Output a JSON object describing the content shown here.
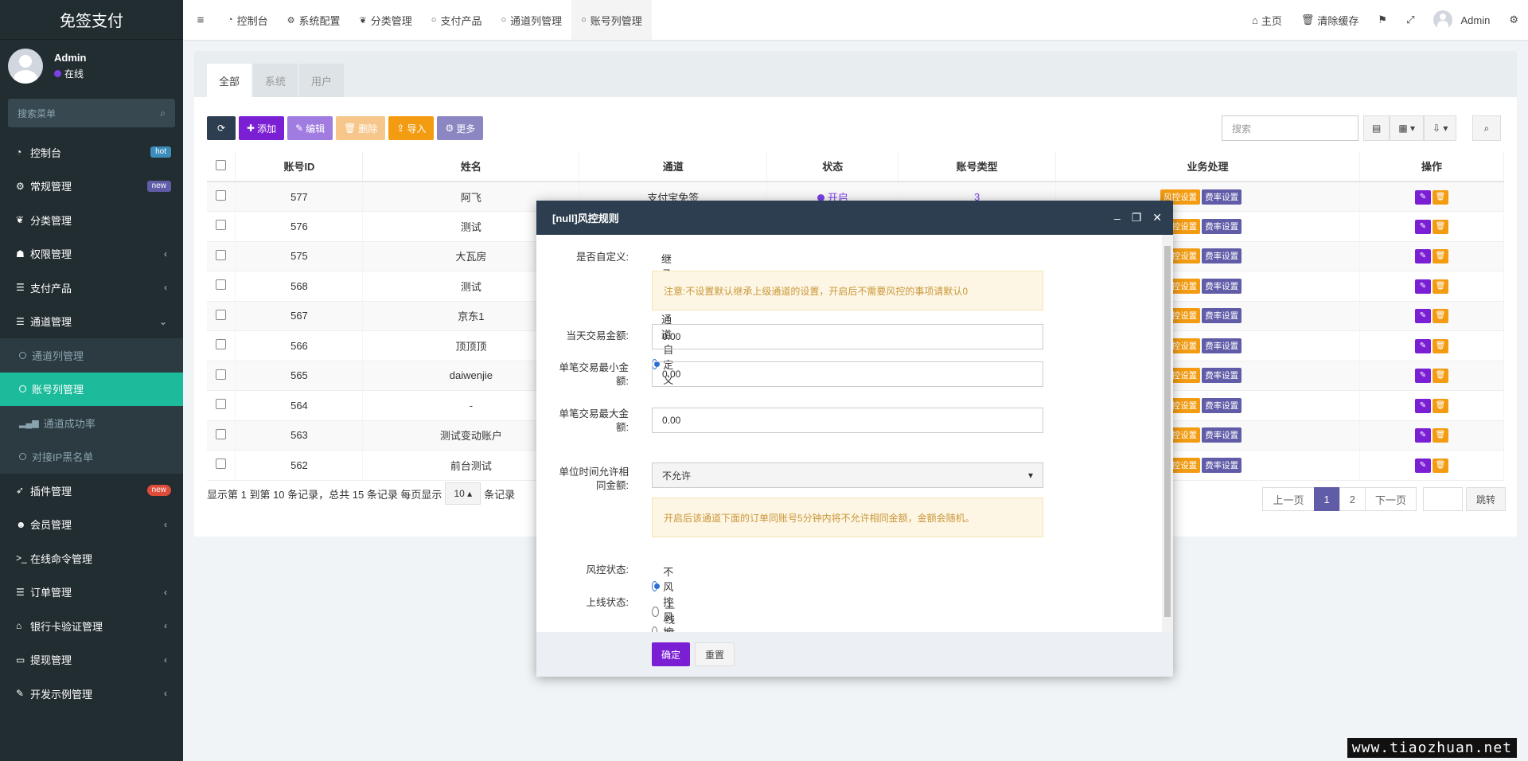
{
  "brand": "免签支付",
  "user": {
    "name": "Admin",
    "status": "在线"
  },
  "sidebar_search_placeholder": "搜索菜单",
  "menu": [
    {
      "icon": "◔",
      "label": "控制台",
      "badge": "hot"
    },
    {
      "icon": "⚙",
      "label": "常规管理",
      "badge": "new"
    },
    {
      "icon": "❦",
      "label": "分类管理"
    },
    {
      "icon": "☗",
      "label": "权限管理",
      "caret": "‹"
    },
    {
      "icon": "☰",
      "label": "支付产品",
      "caret": "‹"
    },
    {
      "icon": "☰",
      "label": "通道管理",
      "caret": "⌄"
    }
  ],
  "submenu": [
    {
      "label": "通道列管理"
    },
    {
      "label": "账号列管理"
    },
    {
      "label": "通道成功率"
    },
    {
      "label": "对接IP黑名单"
    }
  ],
  "menu2": [
    {
      "icon": "➶",
      "label": "插件管理",
      "badge": "new"
    },
    {
      "icon": "☻",
      "label": "会员管理",
      "caret": "‹"
    },
    {
      "icon": ">_",
      "label": "在线命令管理"
    },
    {
      "icon": "☰",
      "label": "订单管理",
      "caret": "‹"
    },
    {
      "icon": "⌂",
      "label": "银行卡验证管理",
      "caret": "‹"
    },
    {
      "icon": "▭",
      "label": "提现管理",
      "caret": "‹"
    },
    {
      "icon": "✎",
      "label": "开发示例管理",
      "caret": "‹"
    }
  ],
  "topbar": {
    "tabs": [
      {
        "icon": "◔",
        "label": "控制台"
      },
      {
        "icon": "⚙",
        "label": "系统配置"
      },
      {
        "icon": "❦",
        "label": "分类管理"
      },
      {
        "icon": "○",
        "label": "支付产品"
      },
      {
        "icon": "○",
        "label": "通道列管理"
      },
      {
        "icon": "○",
        "label": "账号列管理"
      }
    ],
    "home": "主页",
    "clear_cache": "清除缓存",
    "admin": "Admin"
  },
  "panel_tabs": [
    "全部",
    "系统",
    "用户"
  ],
  "toolbar": {
    "add": "添加",
    "edit": "编辑",
    "delete": "删除",
    "import": "导入",
    "more": "更多"
  },
  "search_placeholder": "搜索",
  "columns": [
    "账号ID",
    "姓名",
    "通道",
    "状态",
    "账号类型",
    "业务处理",
    "操作"
  ],
  "rows": [
    {
      "id": "577",
      "name": "阿飞",
      "channel": "支付宝免签",
      "status": "开启",
      "type": "3"
    },
    {
      "id": "576",
      "name": "测试"
    },
    {
      "id": "575",
      "name": "大瓦房"
    },
    {
      "id": "568",
      "name": "测试"
    },
    {
      "id": "567",
      "name": "京东1"
    },
    {
      "id": "566",
      "name": "顶顶顶"
    },
    {
      "id": "565",
      "name": "daiwenjie"
    },
    {
      "id": "564",
      "name": "-"
    },
    {
      "id": "563",
      "name": "测试变动账户"
    },
    {
      "id": "562",
      "name": "前台测试"
    }
  ],
  "biz_buttons": {
    "risk": "风控设置",
    "rate": "费率设置"
  },
  "pagination": {
    "info_prefix": "显示第 1 到第 10 条记录，总共 15 条记录 每页显示",
    "page_size": "10",
    "info_suffix": "条记录",
    "prev": "上一页",
    "pages": [
      "1",
      "2"
    ],
    "next": "下一页",
    "go": "跳转"
  },
  "modal": {
    "title": "[null]风控规则",
    "custom_label": "是否自定义:",
    "custom_opt1": "继承上级通道",
    "custom_opt2": "自定义",
    "note1": "注意:不设置默认继承上级通道的设置，开启后不需要风控的事项请默认0",
    "daily_label": "当天交易金额:",
    "daily_value": "0.00",
    "min_label": "单笔交易最小金额:",
    "min_value": "0.00",
    "max_label": "单笔交易最大金额:",
    "max_value": "0.00",
    "same_label": "单位时间允许相同金额:",
    "same_value": "不允许",
    "note2": "开启后该通道下面的订单同账号5分钟内将不允许相同金额，金额会随机。",
    "risk_label": "风控状态:",
    "risk_opt1": "不风控",
    "risk_opt2": "风控中",
    "online_label": "上线状态:",
    "online_opt1": "上线",
    "online_opt2": "下线",
    "ok": "确定",
    "reset": "重置"
  },
  "watermark": "www.tiaozhuan.net"
}
